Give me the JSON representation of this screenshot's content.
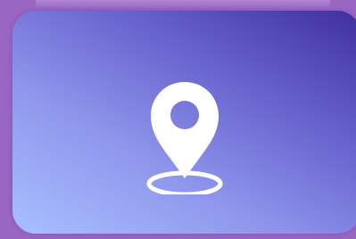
{
  "colors": {
    "background": "#9a66c4",
    "gradient_light": "#a8c0ff",
    "gradient_mid": "#6a66d0",
    "gradient_dark": "#3f2f9c",
    "icon": "#ffffff"
  },
  "card": {
    "icon": "location-pin-icon"
  }
}
